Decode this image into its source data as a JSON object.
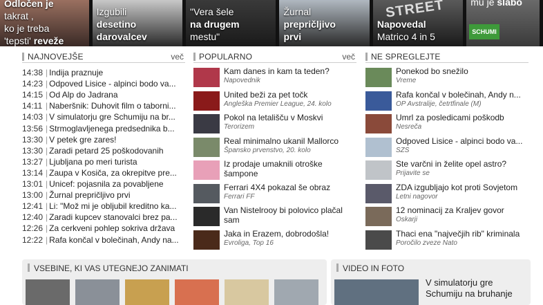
{
  "top_tiles": [
    {
      "line1": "Odločen je",
      "line2": "takrat ,",
      "line3": "ko je treba",
      "line4a": "'tepsti' ",
      "line4b": "reveže"
    },
    {
      "line1": "Izgubili",
      "line2": "desetino",
      "line3": "darovalcev"
    },
    {
      "line1": "\"Vera šele",
      "line2": "na drugem",
      "line3": "mestu\""
    },
    {
      "line1": "Žurnal",
      "line2": "prepričljivo",
      "line3": "prvi"
    },
    {
      "line1": "Napovedal",
      "line2": "Matrico 4 in 5",
      "overlay": "STREET"
    },
    {
      "line1a": "mu je ",
      "line1b": "slabo",
      "badge": "SCHUMI"
    }
  ],
  "najnovejse": {
    "title": "NAJNOVEJŠE",
    "more": "več",
    "items": [
      {
        "time": "14:38",
        "text": "Indija praznuje"
      },
      {
        "time": "14:23",
        "text": "Odpoved Lisice - alpinci bodo va..."
      },
      {
        "time": "14:15",
        "text": "Od Alp do Jadrana"
      },
      {
        "time": "14:11",
        "text": "Naberšnik: Duhovit film o taborni..."
      },
      {
        "time": "14:03",
        "text": "V simulatorju gre Schumiju na br..."
      },
      {
        "time": "13:56",
        "text": "Strmoglavljenega predsednika b..."
      },
      {
        "time": "13:30",
        "text": "V petek gre zares!"
      },
      {
        "time": "13:30",
        "text": "Zaradi petard 25 poškodovanih"
      },
      {
        "time": "13:27",
        "text": "Ljubljana po meri turista"
      },
      {
        "time": "13:14",
        "text": "Zaupa v Kosiča, za okrepitve pre..."
      },
      {
        "time": "13:01",
        "text": "Unicef: pojasnila za povabljene"
      },
      {
        "time": "13:00",
        "text": "Žurnal prepričljivo prvi"
      },
      {
        "time": "12:41",
        "text": "Li: \"Mož mi je obljubil kreditno ka..."
      },
      {
        "time": "12:40",
        "text": "Zaradi kupcev stanovalci brez pa..."
      },
      {
        "time": "12:26",
        "text": "Za cerkveni pohlep sokriva država"
      },
      {
        "time": "12:22",
        "text": "Rafa končal v bolečinah, Andy na..."
      }
    ]
  },
  "popularno": {
    "title": "POPULARNO",
    "more": "več",
    "items": [
      {
        "title": "Kam danes in kam ta teden?",
        "sub": "Napovednik",
        "color": "#b0384a"
      },
      {
        "title": "United beži za pet točk",
        "sub": "Angleška Premier League, 24. kolo",
        "color": "#8a1a1a"
      },
      {
        "title": "Pokol na letališču v Moskvi",
        "sub": "Terorizem",
        "color": "#3a3a44"
      },
      {
        "title": "Real minimalno ukanil Mallorco",
        "sub": "Špansko prvenstvo, 20. kolo",
        "color": "#7a8a6a"
      },
      {
        "title": "Iz prodaje umaknili otroške šampone",
        "sub": "",
        "color": "#e8a0b8"
      },
      {
        "title": "Ferrari 4X4 pokazal še obraz",
        "sub": "Ferrari FF",
        "color": "#555a60"
      },
      {
        "title": "Van Nistelrooy bi polovico plačal sam",
        "sub": "",
        "color": "#2a2a2a"
      },
      {
        "title": "Jaka in Erazem, dobrodošla!",
        "sub": "Evroliga, Top 16",
        "color": "#4a2a1a"
      }
    ]
  },
  "ne_spreglejte": {
    "title": "NE SPREGLEJTE",
    "items": [
      {
        "title": "Ponekod bo snežilo",
        "sub": "Vreme",
        "color": "#6a8a5a"
      },
      {
        "title": "Rafa končal v bolečinah, Andy n...",
        "sub": "OP Avstralije, četrtfinale (M)",
        "color": "#3a5a9a"
      },
      {
        "title": "Umrl za posledicami poškodb",
        "sub": "Nesreča",
        "color": "#8a4a3a"
      },
      {
        "title": "Odpoved Lisice - alpinci bodo va...",
        "sub": "SZS",
        "color": "#b0c0d0"
      },
      {
        "title": "Ste varčni in želite opel astro?",
        "sub": "Prijavite se",
        "color": "#c0c4c8"
      },
      {
        "title": "ZDA izgubljajo kot proti Sovjetom",
        "sub": "Letni nagovor",
        "color": "#5a5a6a"
      },
      {
        "title": "12 nominacij za Kraljev govor",
        "sub": "Oskarji",
        "color": "#7a6a5a"
      },
      {
        "title": "Thaci ena \"največjih rib\" kriminala",
        "sub": "Poročilo zveze Nato",
        "color": "#4a4a4a"
      }
    ]
  },
  "vsebine": {
    "title": "VSEBINE, KI VAS UTEGNEJO ZANIMATI",
    "thumbs": [
      {
        "color": "#6a6a6a"
      },
      {
        "color": "#8a9098"
      },
      {
        "color": "#c8a050"
      },
      {
        "color": "#d87050"
      },
      {
        "color": "#d8c8a0"
      },
      {
        "color": "#a0a8b0"
      }
    ]
  },
  "video": {
    "title": "VIDEO IN FOTO",
    "item_title": "V simulatorju gre Schumiju na bruhanje"
  }
}
